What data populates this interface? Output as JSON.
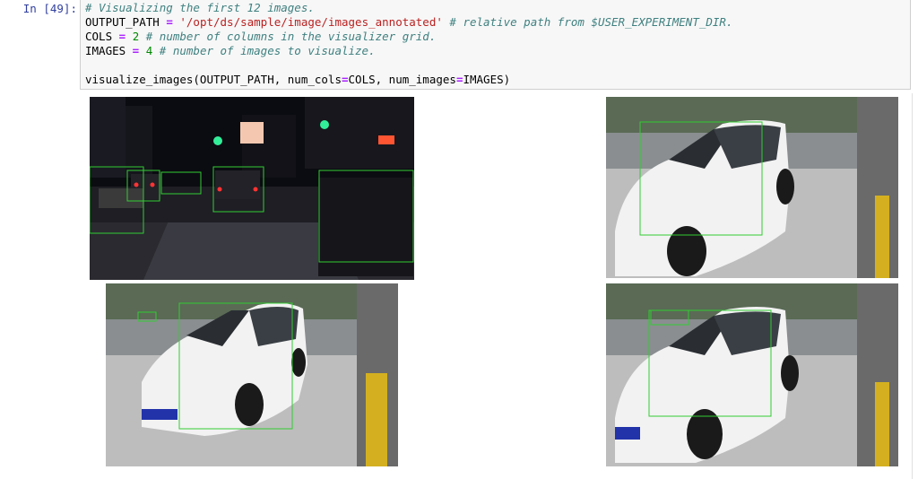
{
  "prompt": "In [49]:",
  "code": {
    "line1_comment": "# Visualizing the first 12 images.",
    "line2_var": "OUTPUT_PATH",
    "line2_eq": " = ",
    "line2_str": "'/opt/ds/sample/image/images_annotated'",
    "line2_comment": " # relative path from $USER_EXPERIMENT_DIR.",
    "line3_var": "COLS",
    "line3_eq": " = ",
    "line3_num": "2",
    "line3_comment": " # number of columns in the visualizer grid.",
    "line4_var": "IMAGES",
    "line4_eq": " = ",
    "line4_num": "4",
    "line4_comment": " # number of images to visualize.",
    "line6_fn": "visualize_images(OUTPUT_PATH, num_cols",
    "line6_eq1": "=",
    "line6_mid": "COLS, num_images",
    "line6_eq2": "=",
    "line6_end": "IMAGES)"
  },
  "output": {
    "images": [
      {
        "label": "night-street-image",
        "scene": "night"
      },
      {
        "label": "white-car-image-1",
        "scene": "car"
      },
      {
        "label": "white-car-image-2",
        "scene": "car"
      },
      {
        "label": "white-car-image-3",
        "scene": "car"
      }
    ],
    "colors": {
      "bbox": "#33cc33",
      "car_body": "#f2f2f2",
      "night_sky": "#0b0b12"
    }
  }
}
